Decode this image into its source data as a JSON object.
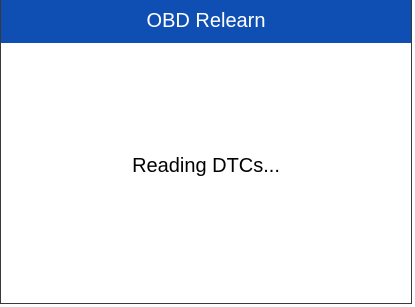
{
  "header": {
    "title": "OBD Relearn"
  },
  "main": {
    "status_message": "Reading DTCs..."
  },
  "colors": {
    "title_bar": "#0f4fb4",
    "title_text": "#ffffff",
    "background": "#ffffff",
    "message_text": "#000000"
  }
}
